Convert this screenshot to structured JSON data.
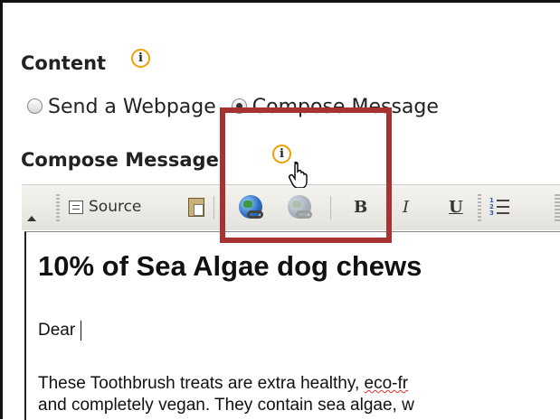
{
  "content_section": {
    "title": "Content",
    "info_icon_glyph": "i",
    "radio_options": [
      {
        "label": "Send a Webpage",
        "checked": false
      },
      {
        "label": "Compose Message",
        "checked": true
      }
    ]
  },
  "compose_section": {
    "title": "Compose Message",
    "info_icon_glyph": "i"
  },
  "toolbar": {
    "source_label": "Source",
    "bold_label": "B",
    "italic_label": "I",
    "underline_label": "U"
  },
  "editor": {
    "heading": "10% of Sea Algae dog chews",
    "greeting": "Dear",
    "paragraph_line1_pre": "These Toothbrush treats are extra healthy, ",
    "paragraph_line1_spell": "eco-fr",
    "paragraph_line2": "and completely vegan. They contain sea algae, w"
  },
  "colors": {
    "info_icon_ring": "#f0a000",
    "highlight_box": "#a83232",
    "toolbar_bg": "#f4f3ef"
  }
}
